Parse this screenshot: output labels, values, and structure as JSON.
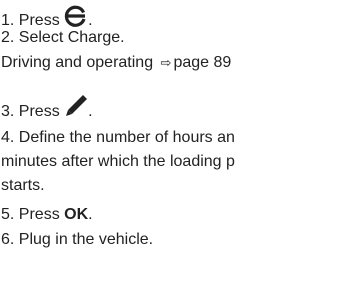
{
  "steps": {
    "s1_prefix": "1. Press",
    "s1_icon": "eco-charge-icon",
    "s1_suffix": ".",
    "s2": "2. Select Charge.",
    "s2_ref_prefix": "Driving and operating",
    "s2_ref_arrow_icon": "arrow-right-icon",
    "s2_ref_page": "page 89",
    "s3_prefix": "3. Press",
    "s3_icon": "pencil-edit-icon",
    "s3_suffix": ".",
    "s4_line1": "4. Define the number of hours an",
    "s4_line2": "minutes after which the loading p",
    "s4_line3": "starts.",
    "s5_prefix": "5. Press ",
    "s5_bold": "OK",
    "s5_suffix": ".",
    "s6": "6. Plug in the vehicle."
  }
}
